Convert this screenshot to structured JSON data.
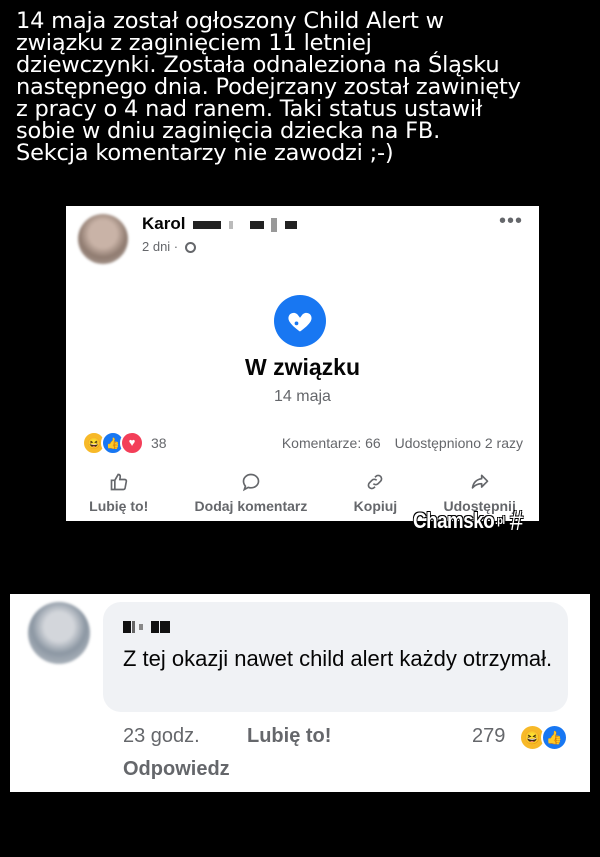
{
  "caption": {
    "text": "14 maja został ogłoszony Child Alert w\nzwiązku z zaginięciem 11 letniej\ndziewczynki. Została odnaleziona na Śląsku\nnastępnego dnia. Podejrzany został zawinięty\nz pracy o 4 nad ranem. Taki status ustawił\nsobie w dniu zaginięcia dziecka na FB.\nSekcja komentarzy nie zawodzi ;-)"
  },
  "post": {
    "author_first": "Karol",
    "time": "2 dni ·",
    "more": "•••",
    "status": "W związku",
    "status_date": "14 maja",
    "reaction_count": "38",
    "comments": "Komentarze: 66",
    "shares": "Udostępniono 2 razy",
    "actions": {
      "like": "Lubię to!",
      "comment": "Dodaj komentarz",
      "copy": "Kopiuj",
      "share": "Udostępnij"
    }
  },
  "watermark": {
    "brand": "Chamsko",
    "tld": ".pl",
    "hash": "#"
  },
  "comment": {
    "text": "Z tej okazji nawet child alert każdy otrzymał.",
    "time": "23 godz.",
    "like": "Lubię to!",
    "count": "279",
    "reply": "Odpowiedz"
  },
  "colors": {
    "brand_blue": "#1877f2",
    "love_red": "#f33e58",
    "haha_yellow": "#f7b928",
    "background": "#000000"
  }
}
